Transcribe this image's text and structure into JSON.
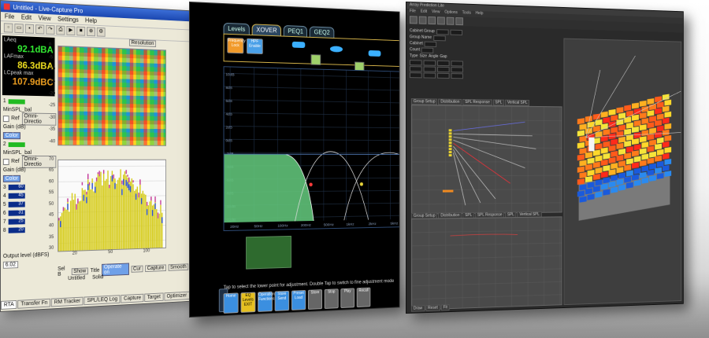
{
  "window1": {
    "title": "Untitled - Live-Capture Pro",
    "menu": [
      "File",
      "Edit",
      "View",
      "Settings",
      "Help"
    ],
    "meters": [
      {
        "label": "LAeq",
        "value": "92.1dBA",
        "color": "#33ee33"
      },
      {
        "label": "LAFmax",
        "value": "86.3dBA",
        "color": "#f0e020"
      },
      {
        "label": "LCpeak max",
        "value": "107.9dBC",
        "color": "#f0a020"
      }
    ],
    "channel_rows": [
      {
        "num": "1",
        "label": "MinSPL_bal",
        "opt": "Omni-Directio"
      },
      {
        "num": "2",
        "label": "MinSPL_bal",
        "opt": "Omni-Directio"
      }
    ],
    "small_labels": {
      "ref": "Ref",
      "gain": "Gain (dB)",
      "color": "Color",
      "res": "Resolution",
      "sel": "Sel B",
      "show": "Show",
      "title_lbl": "Title",
      "untitled": "Untitled",
      "solid": "Solid",
      "operate": "Operate on",
      "cur": "Cur",
      "capture": "Capture",
      "smooth": "Smooth",
      "output_label": "Output level (dBFS)",
      "output_value": "6.02"
    },
    "num_rows": [
      "3",
      "4",
      "5",
      "6",
      "7",
      "8"
    ],
    "num_vals": [
      "60",
      "45",
      "37",
      "31",
      "25",
      "20"
    ],
    "y_ticks_top": [
      "0",
      "-5",
      "-10",
      "-15",
      "-20",
      "-25",
      "-30",
      "-35",
      "-40"
    ],
    "y_ticks_bottom": [
      "70",
      "65",
      "60",
      "55",
      "50",
      "45",
      "40",
      "35",
      "30"
    ],
    "x_ticks": [
      "20",
      "50",
      "100"
    ],
    "tabs": [
      "RTA",
      "Transfer Fn",
      "RM Tracker",
      "SPL/LEQ Log",
      "Capture",
      "Target",
      "Optimizer"
    ]
  },
  "window2": {
    "tabs": [
      "Levels",
      "XOVER",
      "PEQ1",
      "GEQ2"
    ],
    "active_tab": "XOVER",
    "btn_freq_lock": "Frequency Lock",
    "btn_gain_enable": "HPF Enable",
    "y_ticks": [
      "10dB",
      "8dB",
      "6dB",
      "4dB",
      "2dB",
      "0dB",
      "-2dB",
      "-4dB",
      "-6dB",
      "-8dB",
      "-10dB",
      "-12dB"
    ],
    "x_ticks": [
      "20Hz",
      "50Hz",
      "100Hz",
      "200Hz",
      "500Hz",
      "1kHz",
      "2kHz",
      "5kHz"
    ],
    "hint": "Tap to select the lower point for adjustment. Double Tap to switch to fine adjustment mode",
    "bottom_buttons": [
      "Home",
      "EQ Levels EXIT",
      "Operation Functions",
      "Store Send",
      "Preset Load",
      "Store",
      "Stop",
      "Play",
      "Recall"
    ]
  },
  "window3": {
    "title": "Array Prediction Lite",
    "menu": [
      "File",
      "Edit",
      "View",
      "Options",
      "Tools",
      "Help"
    ],
    "section_tabs_top": [
      "Group Setup",
      "Distribution",
      "SPL Response",
      "SPL",
      "Vertical SPL"
    ],
    "section_tabs_bottom": [
      "Group Setup",
      "Distribution",
      "SPL",
      "SPL Response",
      "SPL",
      "Vertical SPL"
    ],
    "legend_items": [
      "Ground Settings",
      "Range",
      "Grid"
    ],
    "form_labels": [
      "Cabinet Group",
      "Group Name",
      "Cabinet",
      "Count",
      "Type",
      "Size",
      "Angle",
      "Gap"
    ],
    "bottom_bar": [
      "Draw",
      "Reset",
      "Fit"
    ]
  }
}
